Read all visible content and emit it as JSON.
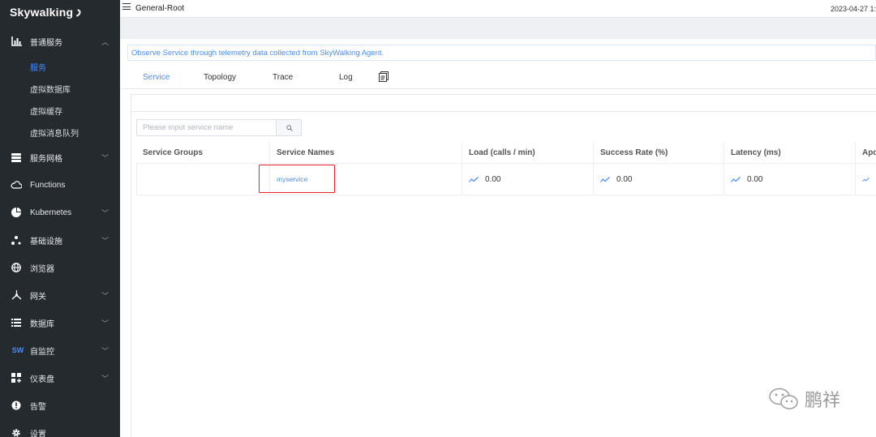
{
  "sidebar": {
    "logo": "Skywalking",
    "items": [
      {
        "label": "普通服务",
        "icon": "chart-icon",
        "expanded": true
      },
      {
        "label": "服务网格",
        "icon": "database-stack-icon"
      },
      {
        "label": "Functions",
        "icon": "cloud-icon"
      },
      {
        "label": "Kubernetes",
        "icon": "pie-icon"
      },
      {
        "label": "基础设施",
        "icon": "nodes-icon"
      },
      {
        "label": "浏览器",
        "icon": "globe-icon"
      },
      {
        "label": "网关",
        "icon": "gateway-icon"
      },
      {
        "label": "数据库",
        "icon": "list-icon"
      },
      {
        "label": "自监控",
        "icon": "sw-icon",
        "icon_text": "SW"
      },
      {
        "label": "仪表盘",
        "icon": "dashboard-icon"
      },
      {
        "label": "告警",
        "icon": "alert-icon"
      },
      {
        "label": "设置",
        "icon": "gear-icon"
      }
    ],
    "subitems": [
      {
        "label": "服务",
        "active": true
      },
      {
        "label": "虚拟数据库"
      },
      {
        "label": "虚拟缓存"
      },
      {
        "label": "虚拟消息队列"
      }
    ]
  },
  "topbar": {
    "breadcrumb": "General-Root",
    "timestamp": "2023-04-27 1:"
  },
  "info_text": "Observe Service through telemetry data collected from SkyWalking Agent.",
  "tabs": [
    {
      "label": "Service",
      "active": true
    },
    {
      "label": "Topology"
    },
    {
      "label": "Trace"
    },
    {
      "label": "Log"
    }
  ],
  "search": {
    "placeholder": "Please input service name"
  },
  "table": {
    "headers": [
      "Service Groups",
      "Service Names",
      "Load (calls / min)",
      "Success Rate (%)",
      "Latency (ms)",
      "Apd"
    ],
    "rows": [
      {
        "group": "",
        "name": "myservice",
        "load": "0.00",
        "success": "0.00",
        "latency": "0.00"
      }
    ]
  },
  "watermark": "鹏祥",
  "colors": {
    "sidebar_bg": "#252a2f",
    "accent": "#448dfe",
    "highlight": "#e5262b"
  }
}
